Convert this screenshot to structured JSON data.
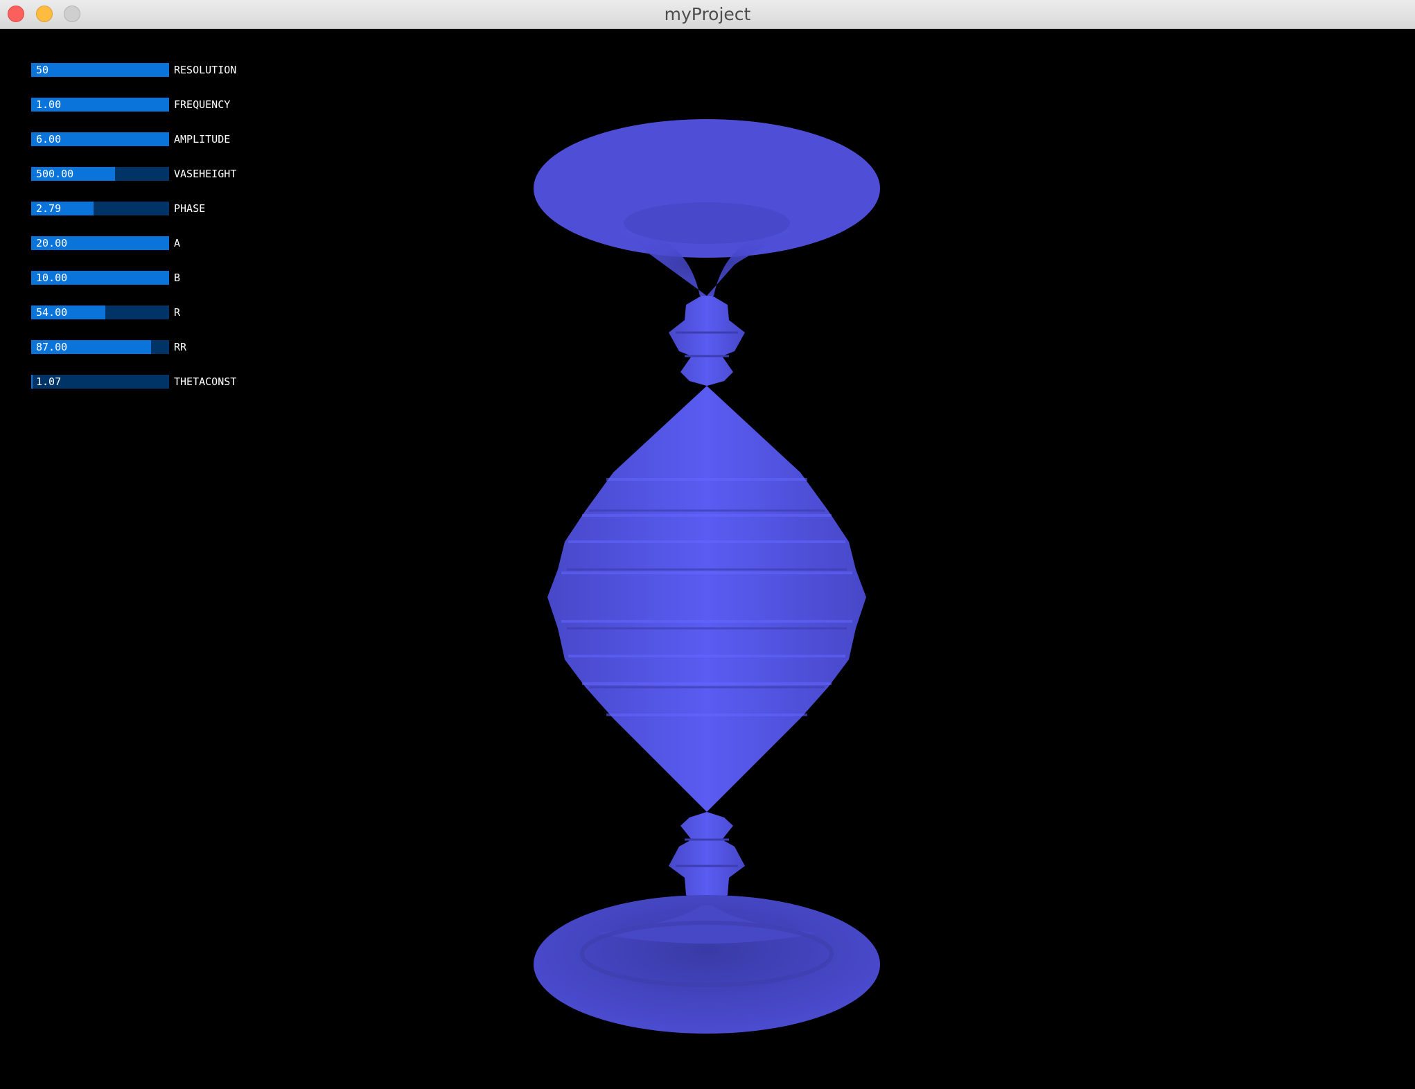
{
  "window": {
    "title": "myProject"
  },
  "sliders": [
    {
      "id": "resolution",
      "value": "50",
      "label": "RESOLUTION",
      "level": 1.0
    },
    {
      "id": "frequency",
      "value": "1.00",
      "label": "FREQUENCY",
      "level": 1.0
    },
    {
      "id": "amplitude",
      "value": "6.00",
      "label": "AMPLITUDE",
      "level": 1.0
    },
    {
      "id": "vaseheight",
      "value": "500.00",
      "label": "VASEHEIGHT",
      "level": 0.61
    },
    {
      "id": "phase",
      "value": "2.79",
      "label": "PHASE",
      "level": 0.45
    },
    {
      "id": "a",
      "value": "20.00",
      "label": "A",
      "level": 1.0
    },
    {
      "id": "b",
      "value": "10.00",
      "label": "B",
      "level": 1.0
    },
    {
      "id": "r",
      "value": "54.00",
      "label": "R",
      "level": 0.54
    },
    {
      "id": "rr",
      "value": "87.00",
      "label": "RR",
      "level": 0.87
    },
    {
      "id": "thetaconst",
      "value": "1.07",
      "label": "THETACONST",
      "level": 0.01
    }
  ],
  "colors": {
    "slider_fill": "#0a74da",
    "slider_track": "#003366",
    "vase_main": "#4f4fdc",
    "vase_light": "#5a5cf2",
    "vase_dark": "#3e3fb0",
    "background": "#000000"
  }
}
